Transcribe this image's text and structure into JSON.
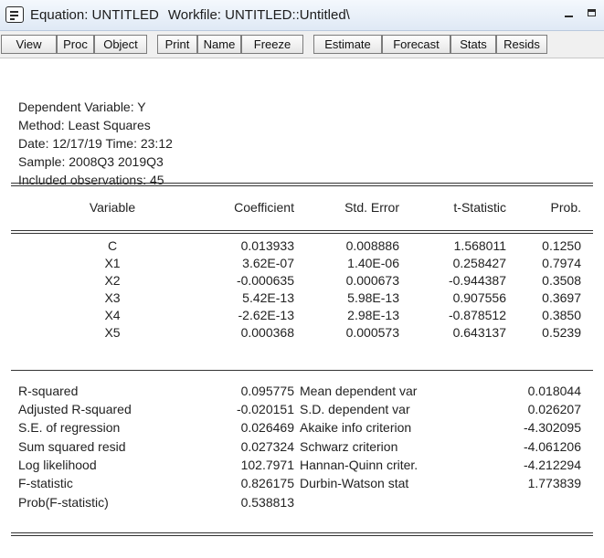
{
  "window": {
    "title_equation": "Equation: UNTITLED",
    "title_workfile": "Workfile: UNTITLED::Untitled\\"
  },
  "toolbar": {
    "buttons": [
      "View",
      "Proc",
      "Object",
      "Print",
      "Name",
      "Freeze",
      "Estimate",
      "Forecast",
      "Stats",
      "Resids"
    ]
  },
  "header": {
    "dependent": "Dependent Variable: Y",
    "method": "Method: Least Squares",
    "date_time": "Date: 12/17/19   Time: 23:12",
    "sample": "Sample: 2008Q3 2019Q3",
    "observations": "Included observations: 45"
  },
  "table": {
    "columns": [
      "Variable",
      "Coefficient",
      "Std. Error",
      "t-Statistic",
      "Prob."
    ],
    "rows": [
      {
        "variable": "C",
        "coefficient": "0.013933",
        "std_error": "0.008886",
        "t_stat": "1.568011",
        "prob": "0.1250"
      },
      {
        "variable": "X1",
        "coefficient": "3.62E-07",
        "std_error": "1.40E-06",
        "t_stat": "0.258427",
        "prob": "0.7974"
      },
      {
        "variable": "X2",
        "coefficient": "-0.000635",
        "std_error": "0.000673",
        "t_stat": "-0.944387",
        "prob": "0.3508"
      },
      {
        "variable": "X3",
        "coefficient": "5.42E-13",
        "std_error": "5.98E-13",
        "t_stat": "0.907556",
        "prob": "0.3697"
      },
      {
        "variable": "X4",
        "coefficient": "-2.62E-13",
        "std_error": "2.98E-13",
        "t_stat": "-0.878512",
        "prob": "0.3850"
      },
      {
        "variable": "X5",
        "coefficient": "0.000368",
        "std_error": "0.000573",
        "t_stat": "0.643137",
        "prob": "0.5239"
      }
    ]
  },
  "stats": {
    "left": [
      {
        "label": "R-squared",
        "value": "0.095775"
      },
      {
        "label": "Adjusted R-squared",
        "value": "-0.020151"
      },
      {
        "label": "S.E. of regression",
        "value": "0.026469"
      },
      {
        "label": "Sum squared resid",
        "value": "0.027324"
      },
      {
        "label": "Log likelihood",
        "value": "102.7971"
      },
      {
        "label": "F-statistic",
        "value": "0.826175"
      },
      {
        "label": "Prob(F-statistic)",
        "value": "0.538813"
      }
    ],
    "right": [
      {
        "label": "Mean dependent var",
        "value": "0.018044"
      },
      {
        "label": "S.D. dependent var",
        "value": "0.026207"
      },
      {
        "label": "Akaike info criterion",
        "value": "-4.302095"
      },
      {
        "label": "Schwarz criterion",
        "value": "-4.061206"
      },
      {
        "label": "Hannan-Quinn criter.",
        "value": "-4.212294"
      },
      {
        "label": "Durbin-Watson stat",
        "value": "1.773839"
      }
    ]
  }
}
